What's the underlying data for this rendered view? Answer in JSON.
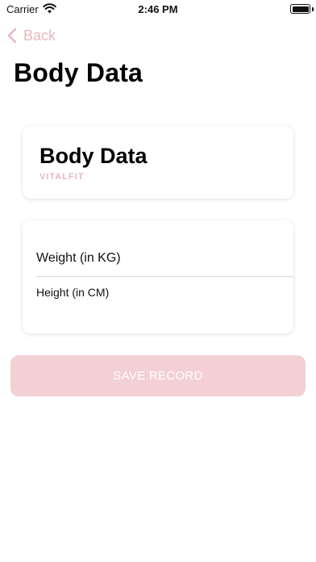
{
  "status_bar": {
    "carrier": "Carrier",
    "time": "2:46 PM"
  },
  "nav": {
    "back_label": "Back",
    "page_title": "Body Data"
  },
  "header_card": {
    "title": "Body Data",
    "subtitle": "VITALFIT"
  },
  "form": {
    "weight": {
      "placeholder": "Weight (in KG)",
      "value": ""
    },
    "height": {
      "placeholder": "Height (in CM)",
      "value": ""
    }
  },
  "save_button": {
    "label": "SAVE RECORD",
    "state": "disabled"
  },
  "colors": {
    "accent": "#e6b8c0",
    "button_bg": "#f3d0d6"
  }
}
